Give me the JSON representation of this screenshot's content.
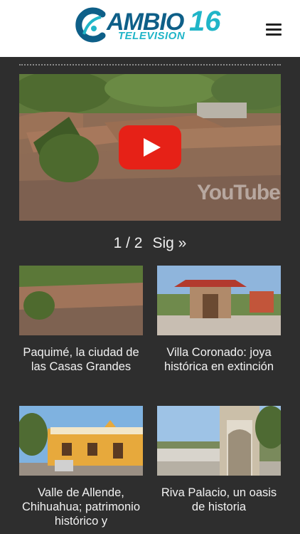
{
  "header": {
    "logo_word": "AMBIO",
    "logo_number": "16",
    "logo_subtitle": "TELEVISION",
    "menu_icon": "hamburger-menu-icon"
  },
  "video": {
    "play_icon": "youtube-play-icon",
    "watermark": "YouTube"
  },
  "pagination": {
    "current": "1 / 2",
    "next_label": "Sig »"
  },
  "articles": [
    {
      "title": "Paquimé, la ciudad de las Casas Grandes"
    },
    {
      "title": "Villa Coronado: joya histórica en extinción"
    },
    {
      "title": "Valle de Allende, Chihuahua; patrimonio histórico y"
    },
    {
      "title": "Riva Palacio, un oasis de historia"
    }
  ],
  "colors": {
    "background": "#2e2e2e",
    "logo_dark": "#0e5f88",
    "logo_light": "#20b5c8",
    "youtube_red": "#e62117"
  }
}
